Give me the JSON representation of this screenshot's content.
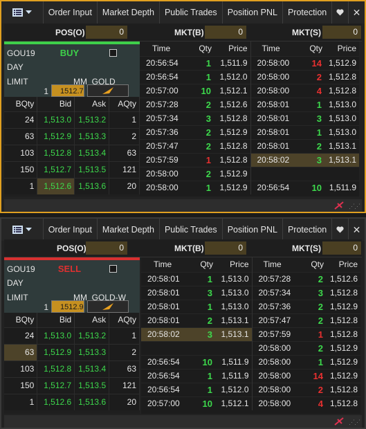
{
  "tabs": [
    "Order Input",
    "Market Depth",
    "Public Trades",
    "Position PNL",
    "Protection"
  ],
  "colors": {
    "active_border": "#e0a020",
    "buy_strip": "#3ed04a",
    "sell_strip": "#d83030",
    "buy_text": "#3ed04a",
    "sell_text": "#e03030",
    "price_up": "#3dd94c",
    "price_down": "#e83030",
    "highlight": "#4d4329",
    "position_value_bg": "#4a3f22"
  },
  "icons": {
    "menu": "list-icon",
    "dropdown": "chevron-down-icon",
    "heart": "heart-icon",
    "close": "close-icon",
    "send": "send-arrow-icon",
    "pin": "pin-icon",
    "grip": "resize-grip-icon"
  },
  "panels": [
    {
      "positions": {
        "pos_label": "POS(O)",
        "pos_value": "0",
        "mkt_b_label": "MKT(B)",
        "mkt_b_value": "0",
        "mkt_s_label": "MKT(S)",
        "mkt_s_value": "0"
      },
      "ticket": {
        "symbol": "GOU19",
        "side": "BUY",
        "tif": "DAY",
        "order_type": "LIMIT",
        "account": "MM_GOLD",
        "quantity": "1",
        "price": "1512.7"
      },
      "depth_headers": [
        "BQty",
        "Bid",
        "Ask",
        "AQty"
      ],
      "depth": [
        [
          "24",
          "1,513.0",
          "1,513.2",
          "1"
        ],
        [
          "63",
          "1,512.9",
          "1,513.3",
          "2"
        ],
        [
          "103",
          "1,512.8",
          "1,513.4",
          "63"
        ],
        [
          "150",
          "1,512.7",
          "1,513.5",
          "121"
        ],
        [
          "1",
          "1,512.6",
          "1,513.6",
          "20"
        ]
      ],
      "trade_headers": [
        "Time",
        "Qty",
        "Price",
        "Time",
        "Qty",
        "Price"
      ],
      "trades": [
        [
          "20:56:54",
          "1",
          "1,511.9",
          "20:58:00",
          "14",
          "1,512.9"
        ],
        [
          "20:56:54",
          "1",
          "1,512.0",
          "20:58:00",
          "2",
          "1,512.8"
        ],
        [
          "20:57:00",
          "10",
          "1,512.1",
          "20:58:00",
          "4",
          "1,512.8"
        ],
        [
          "20:57:28",
          "2",
          "1,512.6",
          "20:58:01",
          "1",
          "1,513.0"
        ],
        [
          "20:57:34",
          "3",
          "1,512.8",
          "20:58:01",
          "3",
          "1,513.0"
        ],
        [
          "20:57:36",
          "2",
          "1,512.9",
          "20:58:01",
          "1",
          "1,513.0"
        ],
        [
          "20:57:47",
          "2",
          "1,512.8",
          "20:58:01",
          "2",
          "1,513.1"
        ],
        [
          "20:57:59",
          "1",
          "1,512.8",
          "20:58:02",
          "3",
          "1,513.1"
        ],
        [
          "20:58:00",
          "2",
          "1,512.9",
          "",
          "",
          ""
        ],
        [
          "20:58:00",
          "1",
          "1,512.9",
          "20:56:54",
          "10",
          "1,511.9"
        ]
      ]
    },
    {
      "positions": {
        "pos_label": "POS(O)",
        "pos_value": "0",
        "mkt_b_label": "MKT(B)",
        "mkt_b_value": "0",
        "mkt_s_label": "MKT(S)",
        "mkt_s_value": "0"
      },
      "ticket": {
        "symbol": "GOU19",
        "side": "SELL",
        "tif": "DAY",
        "order_type": "LIMIT",
        "account": "MM_GOLD-W",
        "quantity": "1",
        "price": "1512.9"
      },
      "depth_headers": [
        "BQty",
        "Bid",
        "Ask",
        "AQty"
      ],
      "depth": [
        [
          "24",
          "1,513.0",
          "1,513.2",
          "1"
        ],
        [
          "63",
          "1,512.9",
          "1,513.3",
          "2"
        ],
        [
          "103",
          "1,512.8",
          "1,513.4",
          "63"
        ],
        [
          "150",
          "1,512.7",
          "1,513.5",
          "121"
        ],
        [
          "1",
          "1,512.6",
          "1,513.6",
          "20"
        ]
      ],
      "trade_headers": [
        "Time",
        "Qty",
        "Price",
        "Time",
        "Qty",
        "Price"
      ],
      "trades": [
        [
          "20:58:01",
          "1",
          "1,513.0",
          "20:57:28",
          "2",
          "1,512.6"
        ],
        [
          "20:58:01",
          "3",
          "1,513.0",
          "20:57:34",
          "3",
          "1,512.8"
        ],
        [
          "20:58:01",
          "1",
          "1,513.0",
          "20:57:36",
          "2",
          "1,512.9"
        ],
        [
          "20:58:01",
          "2",
          "1,513.1",
          "20:57:47",
          "2",
          "1,512.8"
        ],
        [
          "20:58:02",
          "3",
          "1,513.1",
          "20:57:59",
          "1",
          "1,512.8"
        ],
        [
          "",
          "",
          "",
          "20:58:00",
          "2",
          "1,512.9"
        ],
        [
          "20:56:54",
          "10",
          "1,511.9",
          "20:58:00",
          "1",
          "1,512.9"
        ],
        [
          "20:56:54",
          "1",
          "1,511.9",
          "20:58:00",
          "14",
          "1,512.9"
        ],
        [
          "20:56:54",
          "1",
          "1,512.0",
          "20:58:00",
          "2",
          "1,512.8"
        ],
        [
          "20:57:00",
          "10",
          "1,512.1",
          "20:58:00",
          "4",
          "1,512.8"
        ]
      ]
    }
  ]
}
